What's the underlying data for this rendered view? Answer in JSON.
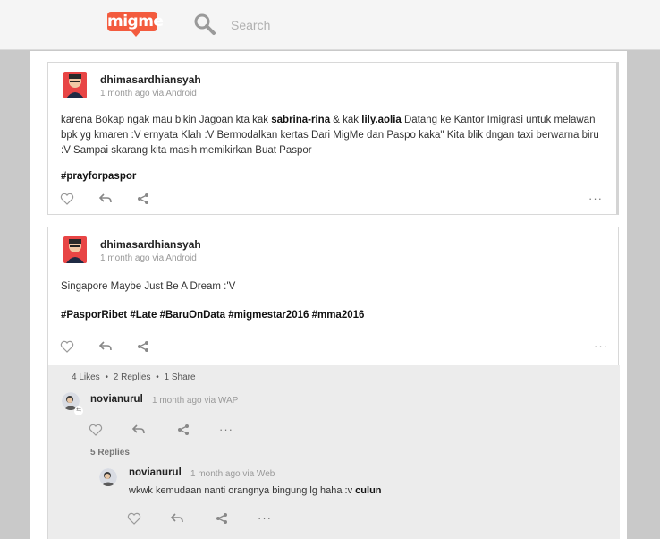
{
  "header": {
    "logo_text": "migme",
    "search_placeholder": "Search",
    "brand_color": "#f35b3e"
  },
  "posts": [
    {
      "author": "dhimasardhiansyah",
      "meta": "1 month ago via Android",
      "text_a": "karena Bokap ngak mau bikin Jagoan kta kak ",
      "mention_1": "sabrina-rina",
      "text_b": " & kak ",
      "mention_2": "lily.aolia",
      "text_c": " Datang ke Kantor Imigrasi untuk melawan bpk yg kmaren :V ernyata Klah :V Bermodalkan kertas Dari MigMe dan Paspo kaka\" Kita blik dngan taxi berwarna biru :V Sampai skarang kita masih memikirkan Buat Paspor",
      "hashtags": "#prayforpaspor",
      "more": "···"
    },
    {
      "author": "dhimasardhiansyah",
      "meta": "1 month ago via Android",
      "text": "Singapore Maybe Just Be A Dream :'V",
      "hashtags": "#PasporRibet #Late #BaruOnData #migmestar2016 #mma2016",
      "more": "···",
      "stats": {
        "likes": "4 Likes",
        "replies": "2 Replies",
        "shares": "1 Share",
        "sep": "•"
      },
      "comment": {
        "author": "novianurul",
        "meta": "1 month ago via WAP",
        "more": "···",
        "replies_label": "5 Replies",
        "reply": {
          "author": "novianurul",
          "meta": "1 month ago via Web",
          "text": "wkwk kemudaan nanti orangnya bingung lg haha :v ",
          "mention": "culun",
          "more": "···"
        }
      }
    }
  ]
}
